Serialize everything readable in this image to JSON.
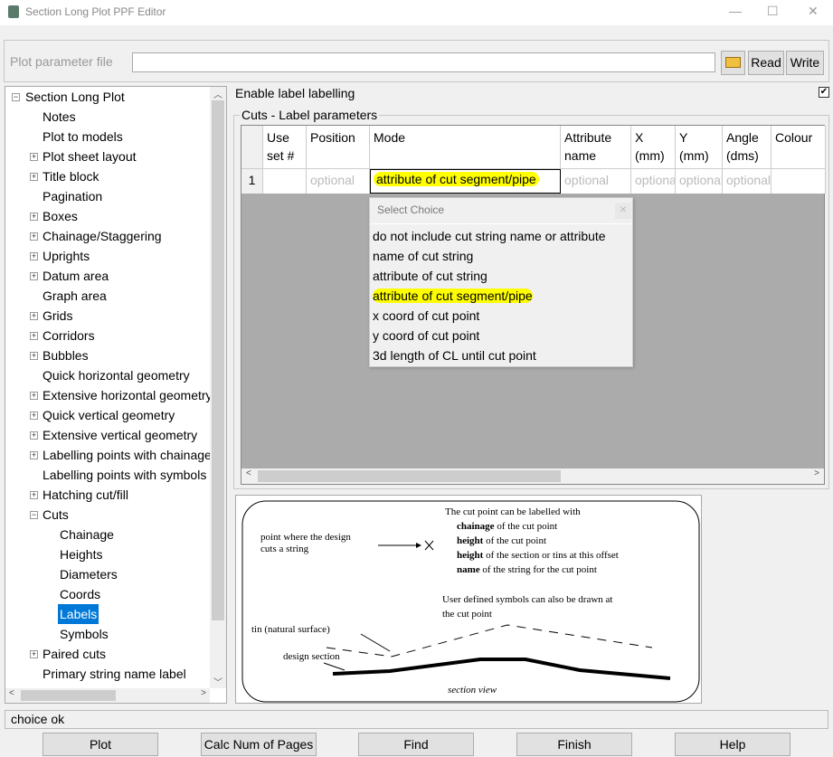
{
  "window": {
    "title": "Section Long Plot PPF Editor"
  },
  "file": {
    "label": "Plot parameter file",
    "value": "",
    "read": "Read",
    "write": "Write"
  },
  "tree": {
    "root": "Section Long Plot",
    "items": [
      "Notes",
      "Plot to models",
      "Plot sheet layout",
      "Title block",
      "Pagination",
      "Boxes",
      "Chainage/Staggering",
      "Uprights",
      "Datum area",
      "Graph area",
      "Grids",
      "Corridors",
      "Bubbles",
      "Quick horizontal geometry",
      "Extensive horizontal geometry",
      "Quick vertical geometry",
      "Extensive vertical geometry",
      "Labelling points with chainage",
      "Labelling points with symbols",
      "Hatching cut/fill",
      "Cuts",
      "Paired cuts",
      "Primary string name label"
    ],
    "cuts_children": [
      "Chainage",
      "Heights",
      "Diameters",
      "Coords",
      "Labels",
      "Symbols"
    ],
    "selected": "Labels"
  },
  "enable": {
    "label": "Enable label labelling",
    "checked": true
  },
  "group": {
    "title": "Cuts - Label parameters"
  },
  "grid": {
    "columns": [
      "",
      "Use set #",
      "Position",
      "Mode",
      "Attribute name",
      "X (mm)",
      "Y (mm)",
      "Angle (dms)",
      "Colour"
    ],
    "rows": [
      [
        "1",
        "",
        "optional",
        "attribute of cut segment/pipe",
        "optional",
        "optional",
        "optional",
        "optional",
        ""
      ]
    ]
  },
  "dropdown": {
    "title": "Select Choice",
    "options": [
      "do not include cut string name or attribute",
      "name of cut string",
      "attribute of cut string",
      "attribute of cut segment/pipe",
      "x coord of cut point",
      "y coord of cut point",
      "3d length of CL until cut point"
    ],
    "selected": "attribute of cut segment/pipe",
    "highlight_color": "#ffff00"
  },
  "diagram": {
    "l1": "point where the design",
    "l2": "cuts a string",
    "h": "The cut point can be labelled with",
    "b1": "chainage",
    "t1": " of the cut point",
    "b2": "height",
    "t2": " of the cut point",
    "b3": "height",
    "t3": " of the section or tins at this offset",
    "b4": "name",
    "t4": " of the string for the cut point",
    "u1": "User defined symbols can also be drawn at",
    "u2": "the cut point",
    "tin": "tin (natural surface)",
    "design": "design section",
    "view": "section view"
  },
  "status": "choice ok",
  "buttons": [
    "Plot",
    "Calc Num of Pages",
    "Find",
    "Finish",
    "Help"
  ]
}
